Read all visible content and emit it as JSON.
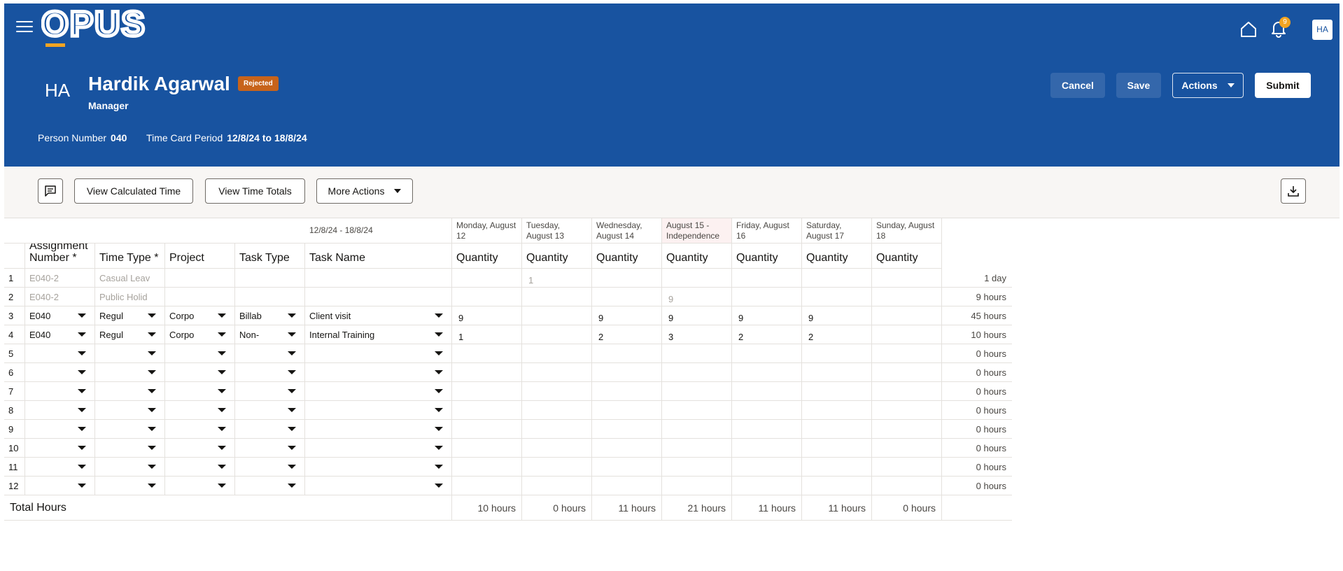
{
  "header": {
    "logo_text": "OPUS",
    "notification_count": "9",
    "user_initials": "HA",
    "person": {
      "initials": "HA",
      "name": "Hardik Agarwal",
      "status": "Rejected",
      "role": "Manager",
      "person_number_label": "Person Number",
      "person_number": "040",
      "period_label": "Time Card Period",
      "period": "12/8/24 to 18/8/24"
    },
    "buttons": {
      "cancel": "Cancel",
      "save": "Save",
      "actions": "Actions",
      "submit": "Submit"
    },
    "colors": {
      "brand_blue": "#1853a0",
      "badge_orange": "#c7631a",
      "notification": "#f2a422"
    }
  },
  "toolbar": {
    "view_calculated_time": "View Calculated Time",
    "view_time_totals": "View Time Totals",
    "more_actions": "More Actions"
  },
  "grid": {
    "period_range": "12/8/24 - 18/8/24",
    "columns": {
      "assignment": "Assignment Number *",
      "time_type": "Time Type *",
      "project": "Project",
      "task_type": "Task Type",
      "task_name": "Task Name"
    },
    "days": [
      {
        "label": "Monday, August 12",
        "sub": "Quantity"
      },
      {
        "label": "Tuesday, August 13",
        "sub": "Quantity"
      },
      {
        "label": "Wednesday, August 14",
        "sub": "Quantity"
      },
      {
        "label": "August 15 - Independence",
        "sub": "Quantity"
      },
      {
        "label": "Friday, August 16",
        "sub": "Quantity"
      },
      {
        "label": "Saturday, August 17",
        "sub": "Quantity"
      },
      {
        "label": "Sunday, August 18",
        "sub": "Quantity"
      }
    ],
    "rows": [
      {
        "no": "1",
        "assignment": "E040-2",
        "time_type": "Casual Leav",
        "project": "",
        "task_type": "",
        "task_name": "",
        "qty": [
          "",
          "1",
          "",
          "",
          "",
          "",
          ""
        ],
        "total": "1 day",
        "readonly": true
      },
      {
        "no": "2",
        "assignment": "E040-2",
        "time_type": "Public Holid",
        "project": "",
        "task_type": "",
        "task_name": "",
        "qty": [
          "",
          "",
          "",
          "9",
          "",
          "",
          ""
        ],
        "total": "9 hours",
        "readonly": true
      },
      {
        "no": "3",
        "assignment": "E040",
        "time_type": "Regul",
        "project": "Corpo",
        "task_type": "Billab",
        "task_name": "Client visit",
        "qty": [
          "9",
          "",
          "9",
          "9",
          "9",
          "9",
          ""
        ],
        "total": "45 hours",
        "readonly": false
      },
      {
        "no": "4",
        "assignment": "E040",
        "time_type": "Regul",
        "project": "Corpo",
        "task_type": "Non-",
        "task_name": "Internal Training",
        "qty": [
          "1",
          "",
          "2",
          "3",
          "2",
          "2",
          ""
        ],
        "total": "10 hours",
        "readonly": false
      },
      {
        "no": "5",
        "assignment": "",
        "time_type": "",
        "project": "",
        "task_type": "",
        "task_name": "",
        "qty": [
          "",
          "",
          "",
          "",
          "",
          "",
          ""
        ],
        "total": "0 hours",
        "readonly": false
      },
      {
        "no": "6",
        "assignment": "",
        "time_type": "",
        "project": "",
        "task_type": "",
        "task_name": "",
        "qty": [
          "",
          "",
          "",
          "",
          "",
          "",
          ""
        ],
        "total": "0 hours",
        "readonly": false
      },
      {
        "no": "7",
        "assignment": "",
        "time_type": "",
        "project": "",
        "task_type": "",
        "task_name": "",
        "qty": [
          "",
          "",
          "",
          "",
          "",
          "",
          ""
        ],
        "total": "0 hours",
        "readonly": false
      },
      {
        "no": "8",
        "assignment": "",
        "time_type": "",
        "project": "",
        "task_type": "",
        "task_name": "",
        "qty": [
          "",
          "",
          "",
          "",
          "",
          "",
          ""
        ],
        "total": "0 hours",
        "readonly": false
      },
      {
        "no": "9",
        "assignment": "",
        "time_type": "",
        "project": "",
        "task_type": "",
        "task_name": "",
        "qty": [
          "",
          "",
          "",
          "",
          "",
          "",
          ""
        ],
        "total": "0 hours",
        "readonly": false
      },
      {
        "no": "10",
        "assignment": "",
        "time_type": "",
        "project": "",
        "task_type": "",
        "task_name": "",
        "qty": [
          "",
          "",
          "",
          "",
          "",
          "",
          ""
        ],
        "total": "0 hours",
        "readonly": false
      },
      {
        "no": "11",
        "assignment": "",
        "time_type": "",
        "project": "",
        "task_type": "",
        "task_name": "",
        "qty": [
          "",
          "",
          "",
          "",
          "",
          "",
          ""
        ],
        "total": "0 hours",
        "readonly": false
      },
      {
        "no": "12",
        "assignment": "",
        "time_type": "",
        "project": "",
        "task_type": "",
        "task_name": "",
        "qty": [
          "",
          "",
          "",
          "",
          "",
          "",
          ""
        ],
        "total": "0 hours",
        "readonly": false
      }
    ],
    "total_label": "Total Hours",
    "day_totals": [
      "10 hours",
      "0 hours",
      "11 hours",
      "21 hours",
      "11 hours",
      "11 hours",
      "0 hours"
    ]
  }
}
